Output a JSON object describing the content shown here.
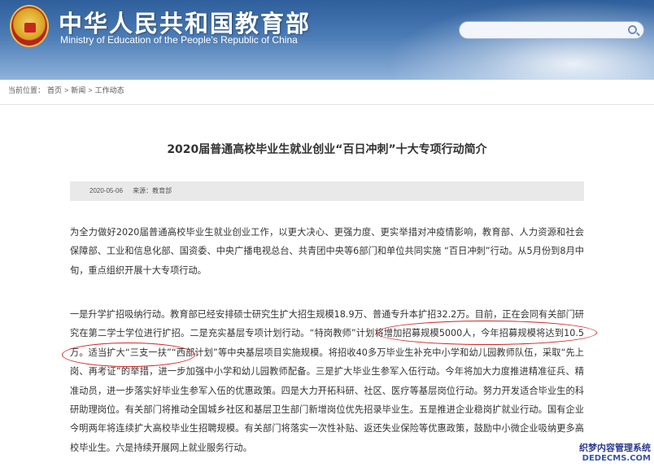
{
  "header": {
    "title": "中华人民共和国教育部",
    "subtitle": "Ministry of Education of the People's Republic of China"
  },
  "search": {
    "placeholder": ""
  },
  "breadcrumb": {
    "prefix": "当前位置：",
    "items": [
      "首页",
      "新闻",
      "工作动态"
    ],
    "separator": ">"
  },
  "article": {
    "title": "2020届普通高校毕业生就业创业“百日冲刺”十大专项行动简介",
    "date": "2020-05-06",
    "source": "来源：教育部",
    "paragraphs": [
      "为全力做好2020届普通高校毕业生就业创业工作，以更大决心、更强力度、更实举措对冲疫情影响，教育部、人力资源和社会保障部、工业和信息化部、国资委、中央广播电视总台、共青团中央等6部门和单位共同实施 “百日冲刺”行动。从5月份到8月中旬，重点组织开展十大专项行动。",
      "一是升学扩招吸纳行动。教育部已经安排硕士研究生扩大招生规模18.9万、普通专升本扩招32.2万。目前，正在会同有关部门研究在第二学士学位进行扩招。二是充实基层专项计划行动。“特岗教师”计划将增加招募规模5000人，今年招募规模将达到10.5万。适当扩大“三支一扶”“西部计划”等中央基层项目实施规模。将招收40多万毕业生补充中小学和幼儿园教师队伍，采取“先上岗、再考证”的举措，进一步加强中小学和幼儿园教师配备。三是扩大毕业生参军入伍行动。今年将加大力度推进精准征兵、精准动员，进一步落实好毕业生参军入伍的优惠政策。四是大力开拓科研、社区、医疗等基层岗位行动。努力开发适合毕业生的科研助理岗位。有关部门将推动全国城乡社区和基层卫生部门新增岗位优先招录毕业生。五是推进企业稳岗扩就业行动。国有企业今明两年将连续扩大高校毕业生招聘规模。有关部门将落实一次性补贴、返还失业保险等优惠政策，鼓励中小微企业吸纳更多高校毕业生。六是持续开展网上就业服务行动。"
    ]
  },
  "watermark": {
    "line1": "织梦内容管理系统",
    "line2": "DEDECMS.COM"
  },
  "colors": {
    "header_top": "#2f5f9c",
    "header_bottom": "#8fb2da",
    "highlight_oval": "#d42424",
    "meta_bar": "#e9e9e9"
  }
}
